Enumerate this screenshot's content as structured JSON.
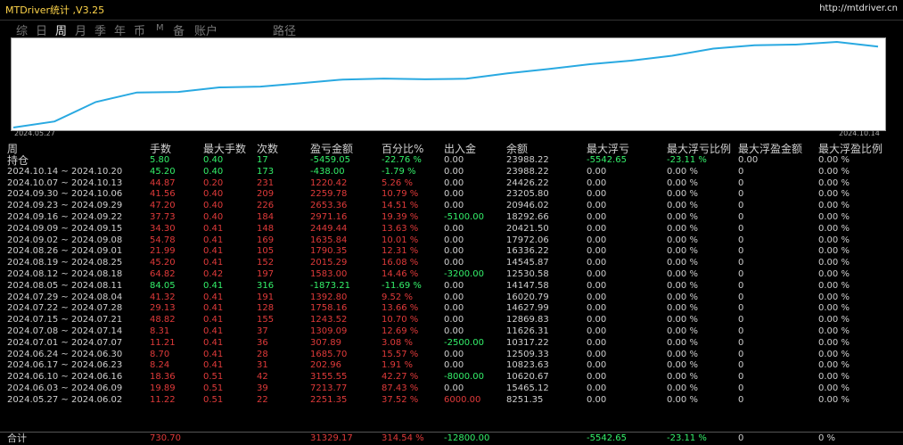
{
  "app": {
    "title": "MTDriver统计 ,V3.25",
    "link": "http://mtdriver.cn"
  },
  "tabs": [
    {
      "label": "综"
    },
    {
      "label": "日"
    },
    {
      "label": "周"
    },
    {
      "label": "月"
    },
    {
      "label": "季"
    },
    {
      "label": "年"
    },
    {
      "label": "币"
    },
    {
      "label": "M"
    },
    {
      "label": "备"
    },
    {
      "label": "账户"
    },
    {
      "label": "路径"
    }
  ],
  "chart_data": {
    "type": "line",
    "x_labels": [
      "2024.05.27",
      "2024.10.14"
    ],
    "series": [
      {
        "color": "#29a9e1",
        "values": [
          0,
          2264.52,
          9478.25,
          13033.76,
          13235.78,
          14921.48,
          15229.37,
          16472.46,
          17844.95,
          18200.44,
          17935.23,
          18137.53,
          20153.93,
          21736.76,
          23529.82,
          24859.48,
          26683.81,
          29338.17,
          30558.59,
          30829.84,
          31829.89,
          30120.22
        ]
      }
    ]
  },
  "table": {
    "columns": [
      "周",
      "手数",
      "最大手数",
      "次数",
      "盈亏金额",
      "百分比%",
      "出入金",
      "余额",
      "最大浮亏",
      "最大浮亏比例",
      "最大浮盈金额",
      "最大浮盈比例"
    ],
    "rows": [
      [
        "持仓",
        "5.80",
        "0.40",
        "17",
        "-5459.05",
        "-22.76 %",
        "0.00",
        "23988.22",
        "-5542.65",
        "-23.11 %",
        "0.00",
        "0.00 %"
      ],
      [
        "2024.10.14 ~ 2024.10.20",
        "45.20",
        "0.40",
        "173",
        "-438.00",
        "-1.79 %",
        "0.00",
        "23988.22",
        "0.00",
        "0.00 %",
        "0",
        "0.00 %"
      ],
      [
        "2024.10.07 ~ 2024.10.13",
        "44.87",
        "0.20",
        "231",
        "1220.42",
        "5.26 %",
        "0.00",
        "24426.22",
        "0.00",
        "0.00 %",
        "0",
        "0.00 %"
      ],
      [
        "2024.09.30 ~ 2024.10.06",
        "41.56",
        "0.40",
        "209",
        "2259.78",
        "10.79 %",
        "0.00",
        "23205.80",
        "0.00",
        "0.00 %",
        "0",
        "0.00 %"
      ],
      [
        "2024.09.23 ~ 2024.09.29",
        "47.20",
        "0.40",
        "226",
        "2653.36",
        "14.51 %",
        "0.00",
        "20946.02",
        "0.00",
        "0.00 %",
        "0",
        "0.00 %"
      ],
      [
        "2024.09.16 ~ 2024.09.22",
        "37.73",
        "0.40",
        "184",
        "2971.16",
        "19.39 %",
        "-5100.00",
        "18292.66",
        "0.00",
        "0.00 %",
        "0",
        "0.00 %"
      ],
      [
        "2024.09.09 ~ 2024.09.15",
        "34.30",
        "0.41",
        "148",
        "2449.44",
        "13.63 %",
        "0.00",
        "20421.50",
        "0.00",
        "0.00 %",
        "0",
        "0.00 %"
      ],
      [
        "2024.09.02 ~ 2024.09.08",
        "54.78",
        "0.41",
        "169",
        "1635.84",
        "10.01 %",
        "0.00",
        "17972.06",
        "0.00",
        "0.00 %",
        "0",
        "0.00 %"
      ],
      [
        "2024.08.26 ~ 2024.09.01",
        "21.99",
        "0.41",
        "105",
        "1790.35",
        "12.31 %",
        "0.00",
        "16336.22",
        "0.00",
        "0.00 %",
        "0",
        "0.00 %"
      ],
      [
        "2024.08.19 ~ 2024.08.25",
        "45.20",
        "0.41",
        "152",
        "2015.29",
        "16.08 %",
        "0.00",
        "14545.87",
        "0.00",
        "0.00 %",
        "0",
        "0.00 %"
      ],
      [
        "2024.08.12 ~ 2024.08.18",
        "64.82",
        "0.42",
        "197",
        "1583.00",
        "14.46 %",
        "-3200.00",
        "12530.58",
        "0.00",
        "0.00 %",
        "0",
        "0.00 %"
      ],
      [
        "2024.08.05 ~ 2024.08.11",
        "84.05",
        "0.41",
        "316",
        "-1873.21",
        "-11.69 %",
        "0.00",
        "14147.58",
        "0.00",
        "0.00 %",
        "0",
        "0.00 %"
      ],
      [
        "2024.07.29 ~ 2024.08.04",
        "41.32",
        "0.41",
        "191",
        "1392.80",
        "9.52 %",
        "0.00",
        "16020.79",
        "0.00",
        "0.00 %",
        "0",
        "0.00 %"
      ],
      [
        "2024.07.22 ~ 2024.07.28",
        "29.13",
        "0.41",
        "128",
        "1758.16",
        "13.66 %",
        "0.00",
        "14627.99",
        "0.00",
        "0.00 %",
        "0",
        "0.00 %"
      ],
      [
        "2024.07.15 ~ 2024.07.21",
        "48.82",
        "0.41",
        "155",
        "1243.52",
        "10.70 %",
        "0.00",
        "12869.83",
        "0.00",
        "0.00 %",
        "0",
        "0.00 %"
      ],
      [
        "2024.07.08 ~ 2024.07.14",
        "8.31",
        "0.41",
        "37",
        "1309.09",
        "12.69 %",
        "0.00",
        "11626.31",
        "0.00",
        "0.00 %",
        "0",
        "0.00 %"
      ],
      [
        "2024.07.01 ~ 2024.07.07",
        "11.21",
        "0.41",
        "36",
        "307.89",
        "3.08 %",
        "-2500.00",
        "10317.22",
        "0.00",
        "0.00 %",
        "0",
        "0.00 %"
      ],
      [
        "2024.06.24 ~ 2024.06.30",
        "8.70",
        "0.41",
        "28",
        "1685.70",
        "15.57 %",
        "0.00",
        "12509.33",
        "0.00",
        "0.00 %",
        "0",
        "0.00 %"
      ],
      [
        "2024.06.17 ~ 2024.06.23",
        "8.24",
        "0.41",
        "31",
        "202.96",
        "1.91 %",
        "0.00",
        "10823.63",
        "0.00",
        "0.00 %",
        "0",
        "0.00 %"
      ],
      [
        "2024.06.10 ~ 2024.06.16",
        "18.36",
        "0.51",
        "42",
        "3155.55",
        "42.27 %",
        "-8000.00",
        "10620.67",
        "0.00",
        "0.00 %",
        "0",
        "0.00 %"
      ],
      [
        "2024.06.03 ~ 2024.06.09",
        "19.89",
        "0.51",
        "39",
        "7213.77",
        "87.43 %",
        "0.00",
        "15465.12",
        "0.00",
        "0.00 %",
        "0",
        "0.00 %"
      ],
      [
        "2024.05.27 ~ 2024.06.02",
        "11.22",
        "0.51",
        "22",
        "2251.35",
        "37.52 %",
        "6000.00",
        "8251.35",
        "0.00",
        "0.00 %",
        "0",
        "0.00 %"
      ]
    ],
    "total": [
      "合计",
      "730.70",
      "",
      "",
      "31329.17",
      "314.54 %",
      "-12800.00",
      "",
      "-5542.65",
      "-23.11 %",
      "0",
      "0 %"
    ]
  },
  "colors": {
    "positive": "#34f06a",
    "negative": "#e03a3a",
    "neutral": "#cfcfcf",
    "title": "#ffd54a",
    "line": "#29a9e1"
  }
}
